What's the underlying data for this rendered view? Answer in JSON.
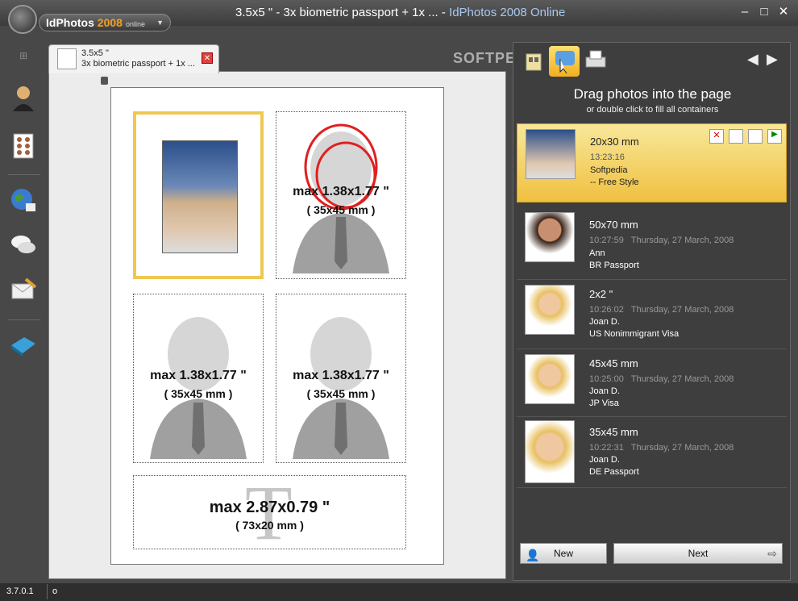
{
  "titlebar": {
    "brand": "IdPhotos",
    "brand_year": "2008",
    "brand_suffix": "online",
    "title_doc": "3.5x5 \" - 3x biometric passport + 1x ...",
    "title_sep": " - ",
    "title_app": "IdPhotos 2008 Online"
  },
  "tab": {
    "line1": "3.5x5 \"",
    "line2": "3x biometric passport + 1x ..."
  },
  "slots": [
    {
      "max": "max 1.38x1.77 \"",
      "mm": "( 35x45 mm )"
    },
    {
      "max": "max 1.38x1.77 \"",
      "mm": "( 35x45 mm )"
    },
    {
      "max": "max 1.38x1.77 \"",
      "mm": "( 35x45 mm )"
    },
    {
      "max": "max 2.87x0.79 \"",
      "mm": "( 73x20 mm )"
    }
  ],
  "right": {
    "title": "Drag photos into the page",
    "subtitle": "or double click to fill all containers",
    "photos": [
      {
        "size": "20x30 mm",
        "time": "13:23:16",
        "name": "Softpedia",
        "style": "-- Free Style"
      },
      {
        "size": "50x70 mm",
        "time": "10:27:59   Thursday, 27 March, 2008",
        "name": "Ann",
        "style": "BR Passport"
      },
      {
        "size": "2x2 \"",
        "time": "10:26:02   Thursday, 27 March, 2008",
        "name": "Joan D.",
        "style": "US Nonimmigrant Visa"
      },
      {
        "size": "45x45 mm",
        "time": "10:25:00   Thursday, 27 March, 2008",
        "name": "Joan D.",
        "style": "JP Visa"
      },
      {
        "size": "35x45 mm",
        "time": "10:22:31   Thursday, 27 March, 2008",
        "name": "Joan D.",
        "style": "DE Passport"
      }
    ],
    "new_label": "New",
    "next_label": "Next"
  },
  "status": {
    "version": "3.7.0.1",
    "field": "o"
  },
  "watermark": "SOFTPEDIA",
  "colors": {
    "selected": "#f0c850",
    "accent": "#f0a020"
  }
}
